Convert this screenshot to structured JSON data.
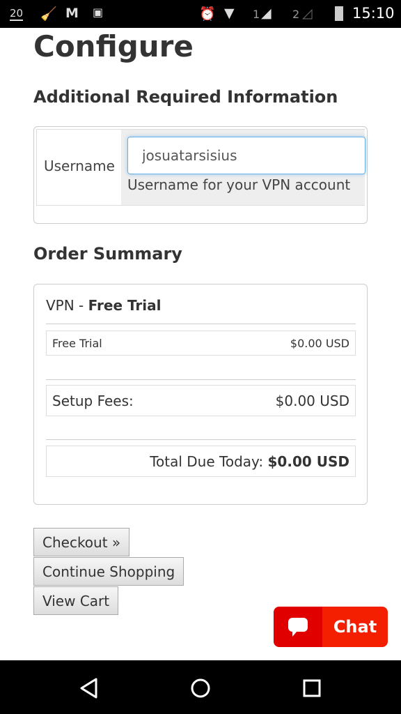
{
  "status_bar": {
    "notification_count": "20",
    "sim1": "1",
    "sim2": "2",
    "time": "15:10",
    "icons": [
      "notification-count-icon",
      "cleaner-icon",
      "gmail-icon",
      "bbm-icon",
      "alarm-icon",
      "wifi-icon",
      "signal-sim1-icon",
      "signal-sim2-icon",
      "battery-icon"
    ]
  },
  "page": {
    "title": "Configure"
  },
  "additional_info": {
    "heading": "Additional Required Information",
    "username_label": "Username",
    "username_value": "josuatarsisius",
    "username_help": "Username for your VPN account"
  },
  "order_summary": {
    "heading": "Order Summary",
    "product_prefix": "VPN - ",
    "product_name": "Free Trial",
    "line_item": {
      "label": "Free Trial",
      "price": "$0.00 USD"
    },
    "setup": {
      "label": "Setup Fees:",
      "price": "$0.00 USD"
    },
    "total": {
      "label": "Total Due Today:",
      "price": "$0.00 USD"
    }
  },
  "buttons": {
    "checkout": "Checkout »",
    "continue": "Continue Shopping",
    "view_cart": "View Cart"
  },
  "chat": {
    "label": "Chat",
    "color_dark": "#e00000",
    "color_light": "#f41e00"
  }
}
